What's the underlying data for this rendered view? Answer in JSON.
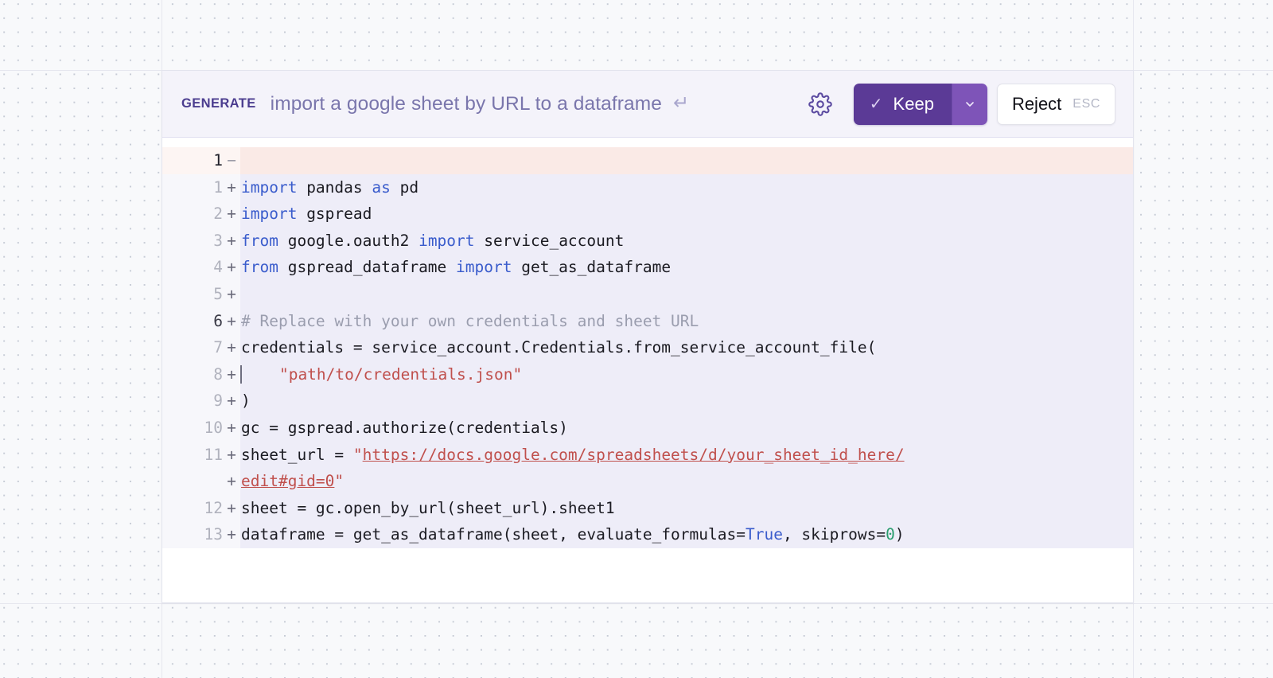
{
  "header": {
    "generate_label": "GENERATE",
    "prompt": "import a google sheet by URL to a dataframe",
    "enter_glyph": "↵",
    "settings_icon": "gear-icon",
    "keep_label": "Keep",
    "keep_check": "✓",
    "keep_caret": "chevron-down-icon",
    "reject_label": "Reject",
    "reject_shortcut": "ESC"
  },
  "colors": {
    "accent_purple": "#5b3a96",
    "accent_purple_light": "#7e54b8",
    "prompt_text": "#7a76ac",
    "generate_label": "#4b3d8f",
    "addition_bg": "#eeedf8",
    "deletion_bg": "#faeae6",
    "keyword": "#3a5ccc",
    "comment": "#9a9dae",
    "string": "#c0504d",
    "number": "#2a9d6e"
  },
  "diff": {
    "rows": [
      {
        "num": "1",
        "sign": "−",
        "type": "del",
        "tokens": []
      },
      {
        "num": "1",
        "sign": "+",
        "type": "add",
        "tokens": [
          {
            "t": "import",
            "c": "kw"
          },
          {
            "t": " pandas ",
            "c": ""
          },
          {
            "t": "as",
            "c": "kw"
          },
          {
            "t": " pd",
            "c": ""
          }
        ]
      },
      {
        "num": "2",
        "sign": "+",
        "type": "add",
        "tokens": [
          {
            "t": "import",
            "c": "kw"
          },
          {
            "t": " gspread",
            "c": ""
          }
        ]
      },
      {
        "num": "3",
        "sign": "+",
        "type": "add",
        "tokens": [
          {
            "t": "from",
            "c": "kw"
          },
          {
            "t": " google.oauth2 ",
            "c": ""
          },
          {
            "t": "import",
            "c": "kw"
          },
          {
            "t": " service_account",
            "c": ""
          }
        ]
      },
      {
        "num": "4",
        "sign": "+",
        "type": "add",
        "tokens": [
          {
            "t": "from",
            "c": "kw"
          },
          {
            "t": " gspread_dataframe ",
            "c": ""
          },
          {
            "t": "import",
            "c": "kw"
          },
          {
            "t": " get_as_dataframe",
            "c": ""
          }
        ]
      },
      {
        "num": "5",
        "sign": "+",
        "type": "add",
        "tokens": []
      },
      {
        "num": "6",
        "sign": "+",
        "type": "add",
        "strong": true,
        "tokens": [
          {
            "t": "# Replace with your own credentials and sheet URL",
            "c": "cmt"
          }
        ]
      },
      {
        "num": "7",
        "sign": "+",
        "type": "add",
        "tokens": [
          {
            "t": "credentials = service_account.Credentials.from_service_account_file(",
            "c": ""
          }
        ]
      },
      {
        "num": "8",
        "sign": "+",
        "type": "add",
        "caret": true,
        "tokens": [
          {
            "t": "    \"path/to/credentials.json\"",
            "c": "str"
          }
        ]
      },
      {
        "num": "9",
        "sign": "+",
        "type": "add",
        "tokens": [
          {
            "t": ")",
            "c": ""
          }
        ]
      },
      {
        "num": "10",
        "sign": "+",
        "type": "add",
        "tokens": [
          {
            "t": "gc = gspread.authorize(credentials)",
            "c": ""
          }
        ]
      },
      {
        "num": "11",
        "sign": "+",
        "type": "add",
        "tokens": [
          {
            "t": "sheet_url = ",
            "c": ""
          },
          {
            "t": "\"",
            "c": "str"
          },
          {
            "t": "https://docs.google.com/spreadsheets/d/your_sheet_id_here/",
            "c": "lnk"
          }
        ]
      },
      {
        "num": "",
        "sign": "+",
        "type": "add",
        "tokens": [
          {
            "t": "edit#gid=0",
            "c": "lnk"
          },
          {
            "t": "\"",
            "c": "str"
          }
        ]
      },
      {
        "num": "12",
        "sign": "+",
        "type": "add",
        "tokens": [
          {
            "t": "sheet = gc.open_by_url(sheet_url).sheet1",
            "c": ""
          }
        ]
      },
      {
        "num": "13",
        "sign": "+",
        "type": "add",
        "tokens": [
          {
            "t": "dataframe = get_as_dataframe(sheet, evaluate_formulas=",
            "c": ""
          },
          {
            "t": "True",
            "c": "kw"
          },
          {
            "t": ", skiprows=",
            "c": ""
          },
          {
            "t": "0",
            "c": "num"
          },
          {
            "t": ")",
            "c": ""
          }
        ]
      }
    ]
  }
}
